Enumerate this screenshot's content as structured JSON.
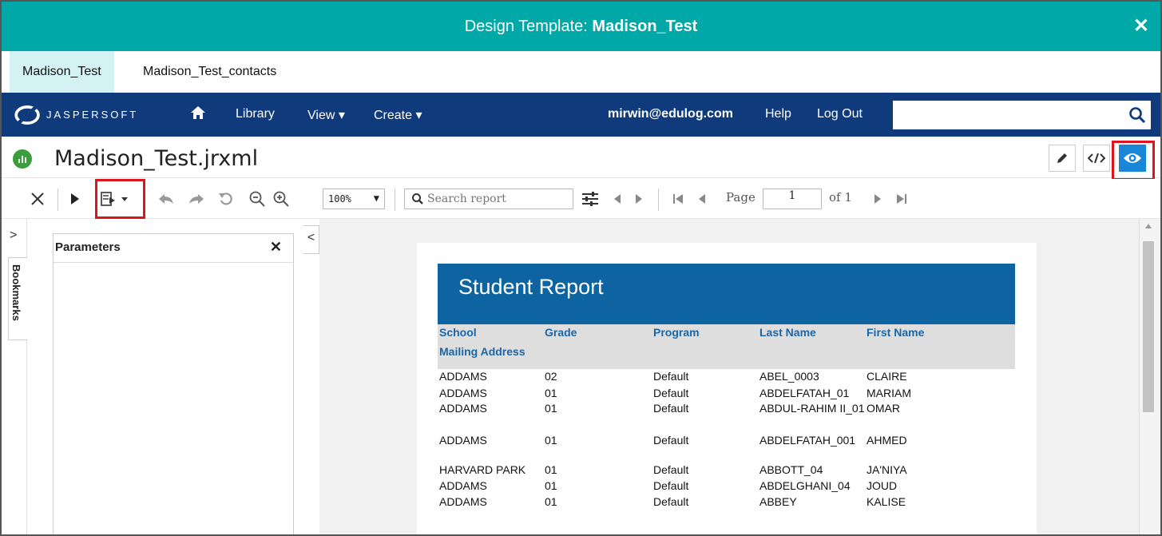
{
  "window": {
    "title_prefix": "Design Template: ",
    "title_name": "Madison_Test",
    "close_label": "✕"
  },
  "tabs": [
    {
      "label": "Madison_Test"
    },
    {
      "label": "Madison_Test_contacts"
    }
  ],
  "nav": {
    "brand": "JASPERSOFT",
    "library": "Library",
    "view": "View ▾",
    "create": "Create ▾",
    "user": "mirwin@edulog.com",
    "help": "Help",
    "logout": "Log Out",
    "search_value": ""
  },
  "report": {
    "file_title": "Madison_Test.jrxml"
  },
  "toolbar": {
    "zoom": "100%",
    "search_placeholder": "Search report",
    "page_label": "Page",
    "page_value": "1",
    "of_label": "of 1"
  },
  "panels": {
    "bookmarks_label": "Bookmarks",
    "parameters_title": "Parameters"
  },
  "document": {
    "title": "Student Report",
    "headers": {
      "school": "School",
      "grade": "Grade",
      "program": "Program",
      "last_name": "Last Name",
      "first_name": "First Name",
      "mailing": "Mailing Address"
    },
    "rows": [
      {
        "school": "ADDAMS",
        "grade": "02",
        "program": "Default",
        "last": "ABEL_0003",
        "first": "CLAIRE"
      },
      {
        "school": "ADDAMS",
        "grade": "01",
        "program": "Default",
        "last": "ABDELFATAH_01",
        "first": "MARIAM"
      },
      {
        "school": "ADDAMS",
        "grade": "01",
        "program": "Default",
        "last": "ABDUL-RAHIM II_01",
        "first": "OMAR"
      },
      {
        "school": "ADDAMS",
        "grade": "01",
        "program": "Default",
        "last": "ABDELFATAH_001",
        "first": "AHMED"
      },
      {
        "school": "HARVARD PARK",
        "grade": "01",
        "program": "Default",
        "last": "ABBOTT_04",
        "first": "JA'NIYA"
      },
      {
        "school": "ADDAMS",
        "grade": "01",
        "program": "Default",
        "last": "ABDELGHANI_04",
        "first": "JOUD"
      },
      {
        "school": "ADDAMS",
        "grade": "01",
        "program": "Default",
        "last": "ABBEY",
        "first": "KALISE"
      }
    ]
  }
}
